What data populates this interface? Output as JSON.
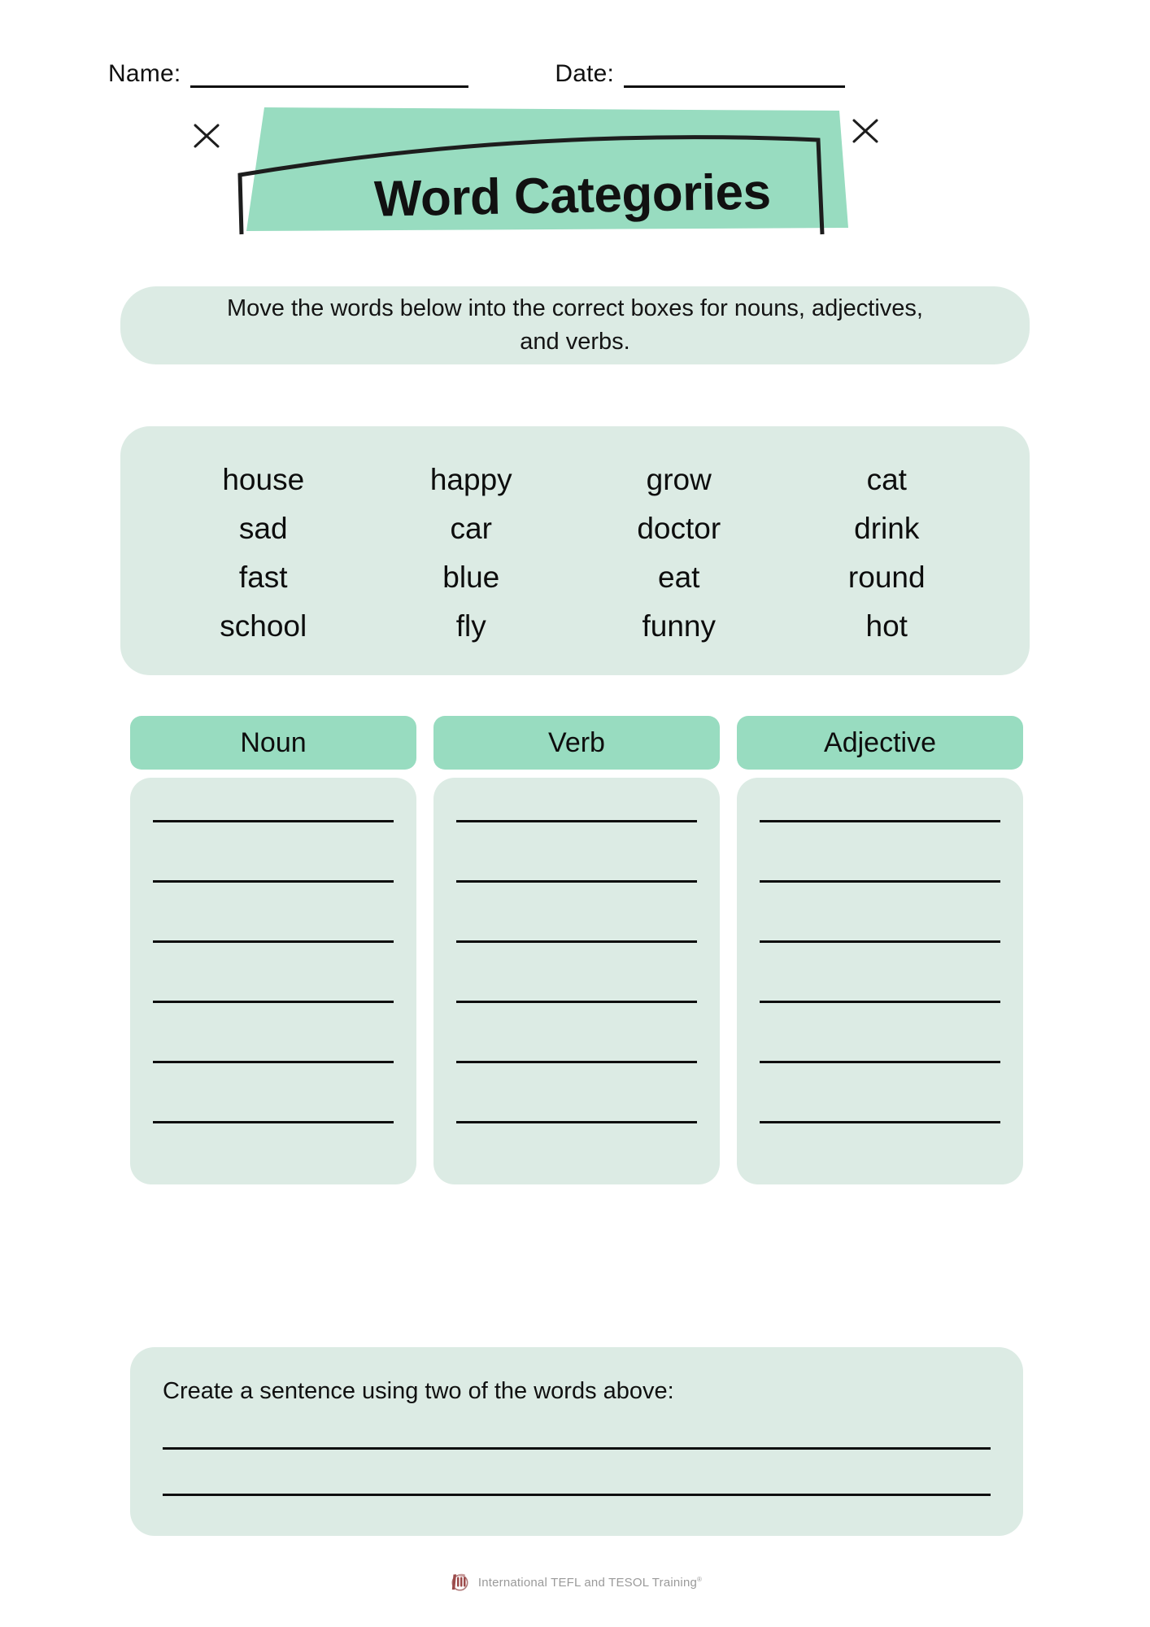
{
  "header": {
    "name_label": "Name:",
    "date_label": "Date:"
  },
  "title": {
    "text": "Word Categories",
    "accent_color": "#98dcc0",
    "outline_color": "#1d1d1d"
  },
  "instructions": {
    "text": "Move the words below into the correct boxes for nouns, adjectives, and verbs."
  },
  "word_bank": {
    "panel_color": "#dcebe4",
    "columns": [
      [
        "house",
        "sad",
        "fast",
        "school"
      ],
      [
        "happy",
        "car",
        "blue",
        "fly"
      ],
      [
        "grow",
        "doctor",
        "eat",
        "funny"
      ],
      [
        "cat",
        "drink",
        "round",
        "hot"
      ]
    ],
    "words_row_major": [
      "house",
      "happy",
      "grow",
      "cat",
      "sad",
      "car",
      "doctor",
      "drink",
      "fast",
      "blue",
      "eat",
      "round",
      "school",
      "fly",
      "funny",
      "hot"
    ]
  },
  "categories": {
    "header_color": "#98dcc0",
    "body_color": "#dcebe4",
    "lines_per_column": 6,
    "items": [
      {
        "label": "Noun"
      },
      {
        "label": "Verb"
      },
      {
        "label": "Adjective"
      }
    ]
  },
  "sentence_task": {
    "label": "Create a sentence using two of the words above:",
    "lines": 2
  },
  "footer": {
    "brand": "International TEFL  and TESOL Training",
    "trademark": "®",
    "logo_color": "#9c4a4a"
  }
}
